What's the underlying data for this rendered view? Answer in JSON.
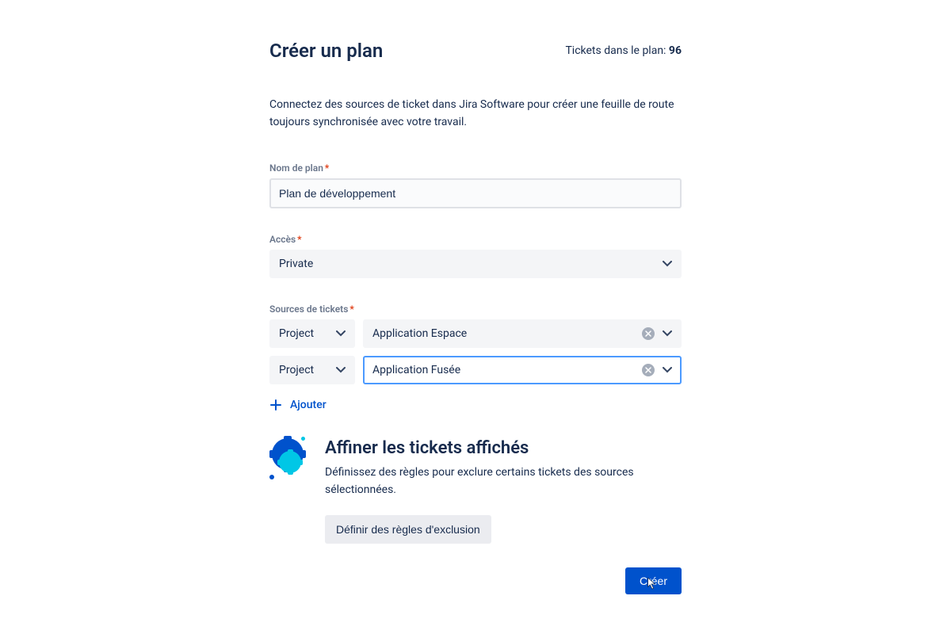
{
  "header": {
    "title": "Créer un plan",
    "ticket_count_label": "Tickets dans le plan: ",
    "ticket_count_value": "96"
  },
  "description": "Connectez des sources de ticket dans Jira Software pour créer une feuille de route toujours synchronisée avec votre travail.",
  "fields": {
    "plan_name": {
      "label": "Nom de plan",
      "value": "Plan de développement"
    },
    "access": {
      "label": "Accès",
      "value": "Private"
    },
    "sources": {
      "label": "Sources de tickets",
      "rows": [
        {
          "type": "Project",
          "value": "Application Espace",
          "focused": false
        },
        {
          "type": "Project",
          "value": "Application Fusée",
          "focused": true
        }
      ],
      "add_label": "Ajouter"
    }
  },
  "refine": {
    "title": "Affiner les tickets affichés",
    "description": "Définissez des règles pour exclure certains tickets des sources sélectionnées.",
    "button": "Définir des règles d'exclusion"
  },
  "actions": {
    "create": "Créer"
  },
  "colors": {
    "primary": "#0052cc",
    "accent": "#00c7e6",
    "required": "#de350b"
  }
}
